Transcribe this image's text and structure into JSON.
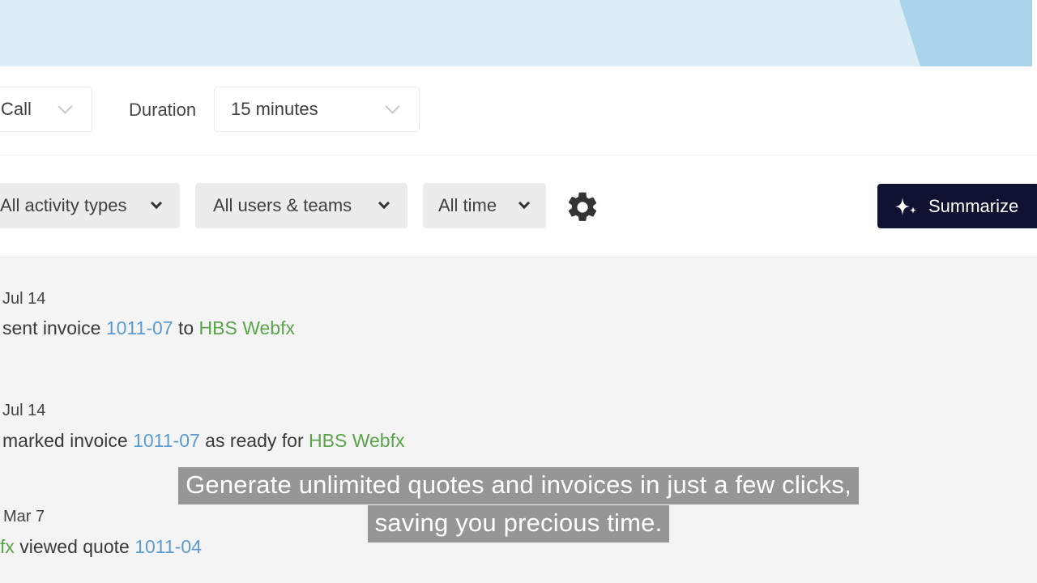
{
  "form": {
    "call_value": "Call",
    "duration_label": "Duration",
    "duration_value": "15 minutes"
  },
  "filters": {
    "activity_types": "All activity types",
    "users_teams": "All users & teams",
    "time_range": "All time",
    "summarize_label": "Summarize"
  },
  "feed": [
    {
      "date": "Jul 14",
      "prefix": "sent invoice ",
      "ref": "1011-07",
      "middle": " to ",
      "client": "HBS Webfx"
    },
    {
      "date": "Jul 14",
      "prefix": "marked invoice ",
      "ref": "1011-07",
      "middle": " as ready for ",
      "client": "HBS Webfx"
    },
    {
      "date": "Mar 7",
      "client_tail": "fx",
      "middle": " viewed quote ",
      "ref": "1011-04"
    }
  ],
  "caption": {
    "line1": "Generate unlimited quotes and invoices in just a few clicks,",
    "line2": "saving you precious time."
  },
  "colors": {
    "banner": "#dcedf6",
    "banner_accent": "#a9d4ec",
    "summarize_bg": "#0f1230",
    "link_blue": "#5b9bd1",
    "link_green": "#5aa34a"
  }
}
